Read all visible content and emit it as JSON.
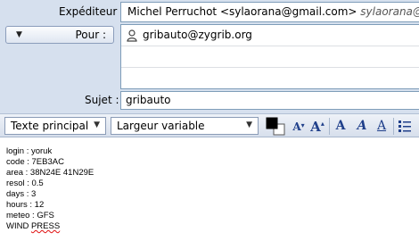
{
  "compose": {
    "from_label": "Expéditeur :",
    "from_name": "Michel Perruchot <sylaorana@gmail.com>",
    "from_alt": "sylaorana@gmail.c",
    "to_label": "Pour :",
    "to_recipient": "gribauto@zygrib.org",
    "subject_label": "Sujet :",
    "subject_value": "gribauto"
  },
  "toolbar": {
    "paragraph_style": "Texte principal",
    "font_width": "Largeur variable",
    "text_color": "#000000"
  },
  "body_lines": [
    "login : yoruk",
    "code : 7EB3AC",
    "area : 38N24E 41N29E",
    "resol : 0.5",
    "days : 3",
    "hours : 12",
    "meteo : GFS"
  ],
  "body_last": {
    "word1": "WIND",
    "word2": "PRESS"
  }
}
